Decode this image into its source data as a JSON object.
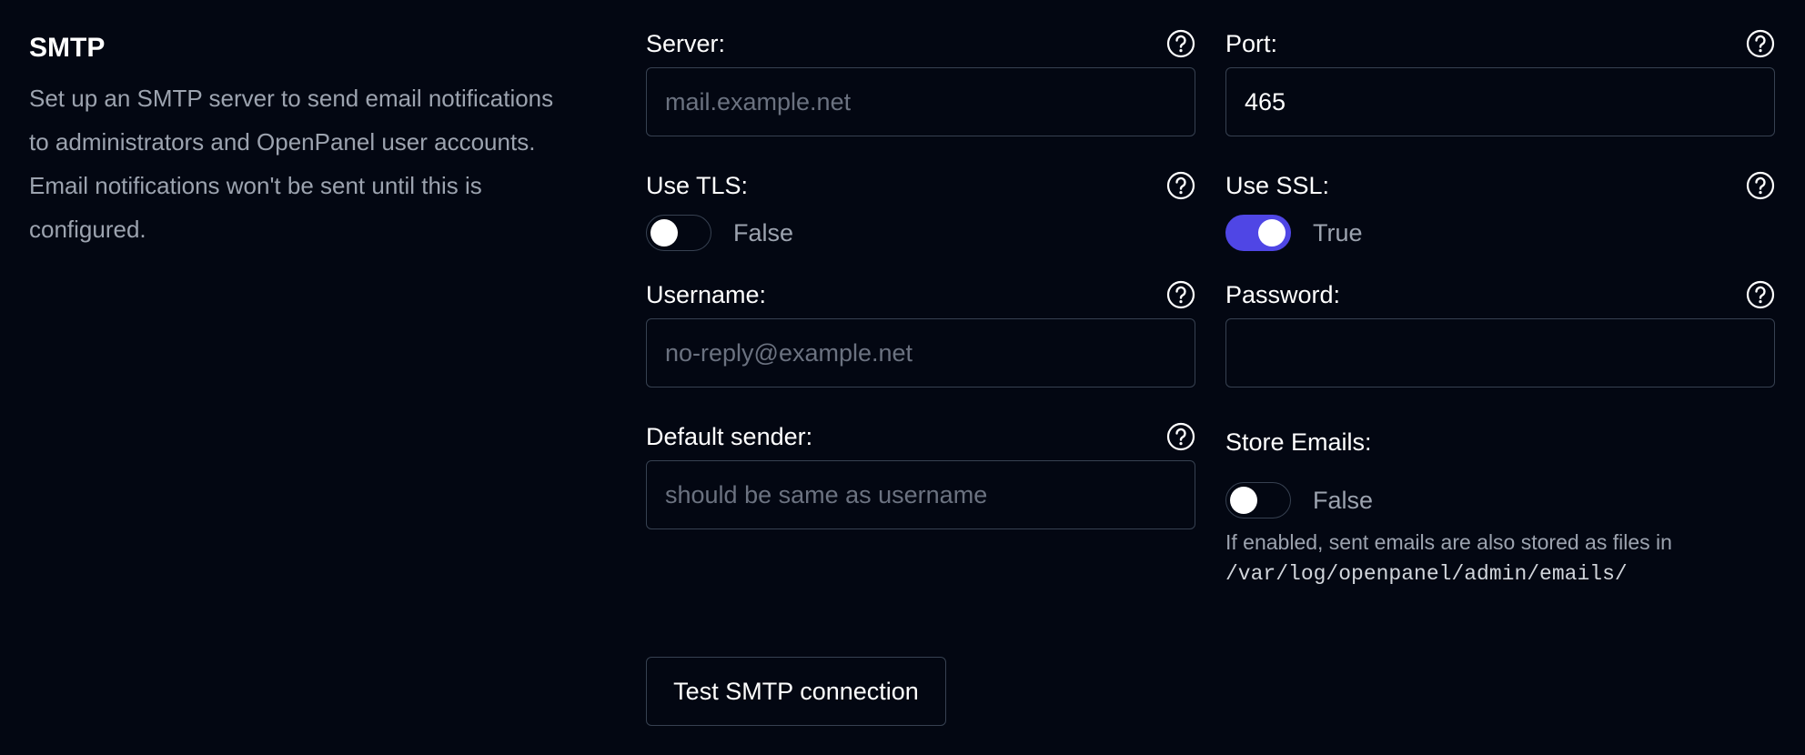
{
  "section": {
    "title": "SMTP",
    "description": "Set up an SMTP server to send email notifications to administrators and OpenPanel user accounts. Email notifications won't be sent until this is configured."
  },
  "server": {
    "label": "Server:",
    "value": "",
    "placeholder": "mail.example.net"
  },
  "port": {
    "label": "Port:",
    "value": "465",
    "placeholder": ""
  },
  "use_tls": {
    "label": "Use TLS:",
    "state": "False",
    "on": false
  },
  "use_ssl": {
    "label": "Use SSL:",
    "state": "True",
    "on": true
  },
  "username": {
    "label": "Username:",
    "value": "",
    "placeholder": "no-reply@example.net"
  },
  "password": {
    "label": "Password:",
    "value": "",
    "placeholder": ""
  },
  "default_sender": {
    "label": "Default sender:",
    "value": "",
    "placeholder": "should be same as username"
  },
  "store_emails": {
    "label": "Store Emails:",
    "state": "False",
    "on": false,
    "note": "If enabled, sent emails are also stored as files in",
    "path": "/var/log/openpanel/admin/emails/"
  },
  "test_button": {
    "label": "Test SMTP connection"
  },
  "icons": {
    "help": "question-circle-icon"
  },
  "colors": {
    "background": "#030712",
    "accent": "#4f46e5",
    "muted_text": "#9ca3af",
    "border": "#374151"
  }
}
